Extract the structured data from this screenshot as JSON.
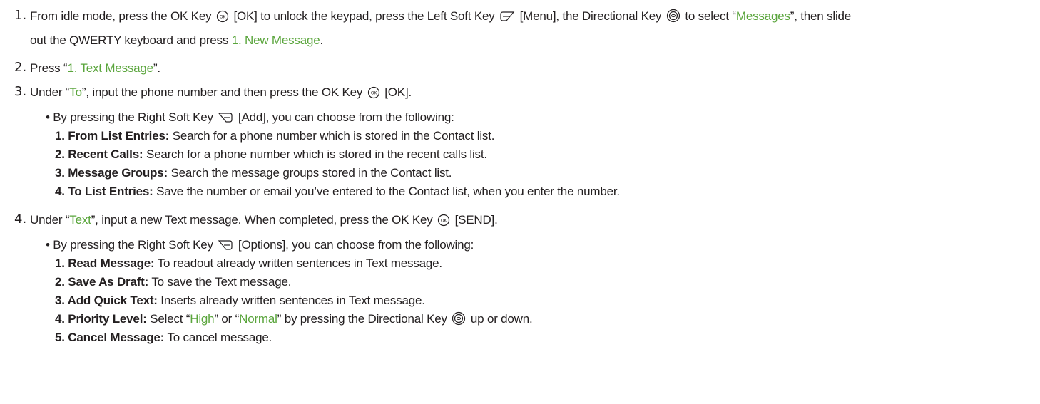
{
  "steps": [
    {
      "number": "1.",
      "parts": {
        "a": "From idle mode, press the OK Key",
        "b": "[OK] to unlock the keypad, press the Left Soft Key",
        "c": "[Menu], the Directional Key",
        "d": "to select “",
        "e": "Messages",
        "f": "”, then slide",
        "g": "out the QWERTY keyboard and press",
        "h": "1. New Message",
        "i": "."
      }
    },
    {
      "number": "2.",
      "parts": {
        "a": "Press “",
        "b": "1. Text Message",
        "c": "”."
      }
    },
    {
      "number": "3.",
      "parts": {
        "a": "Under “",
        "b": "To",
        "c": "”, input the phone number and then press the OK Key",
        "d": "[OK]."
      },
      "bullet": {
        "a": "By pressing the Right Soft Key",
        "b": "[Add], you can choose from the following:"
      },
      "options": [
        {
          "label": "1. From List Entries:",
          "text": "Search for a phone number which is stored in the Contact list."
        },
        {
          "label": "2. Recent Calls:",
          "text": "Search for a phone number which is stored in the recent calls list."
        },
        {
          "label": "3. Message Groups:",
          "text": "Search the message groups stored in the Contact list."
        },
        {
          "label": "4. To List Entries:",
          "text": "Save the number or email you’ve entered to the Contact list, when you enter the number."
        }
      ]
    },
    {
      "number": "4.",
      "parts": {
        "a": "Under “",
        "b": "Text",
        "c": "”, input a new Text message. When completed, press the OK Key",
        "d": "[SEND]."
      },
      "bullet": {
        "a": "By pressing the Right Soft Key",
        "b": "[Options], you can choose from the following:"
      },
      "options": [
        {
          "label": "1. Read Message:",
          "text": "To readout already written sentences in Text message."
        },
        {
          "label": "2. Save As Draft:",
          "text": "To save the Text message."
        },
        {
          "label": "3. Add Quick Text:",
          "text": "Inserts already written sentences in Text message."
        },
        {
          "label": "4. Priority Level:",
          "text_a": "Select “",
          "high": "High",
          "text_b": "” or “",
          "normal": "Normal",
          "text_c": "” by pressing the Directional Key",
          "text_d": "up or down."
        },
        {
          "label": "5. Cancel Message:",
          "text": "To cancel message."
        }
      ]
    }
  ],
  "accent_color": "#5aa53c",
  "icons": [
    "ok-key-icon",
    "left-soft-key-icon",
    "right-soft-key-icon",
    "directional-key-icon"
  ]
}
